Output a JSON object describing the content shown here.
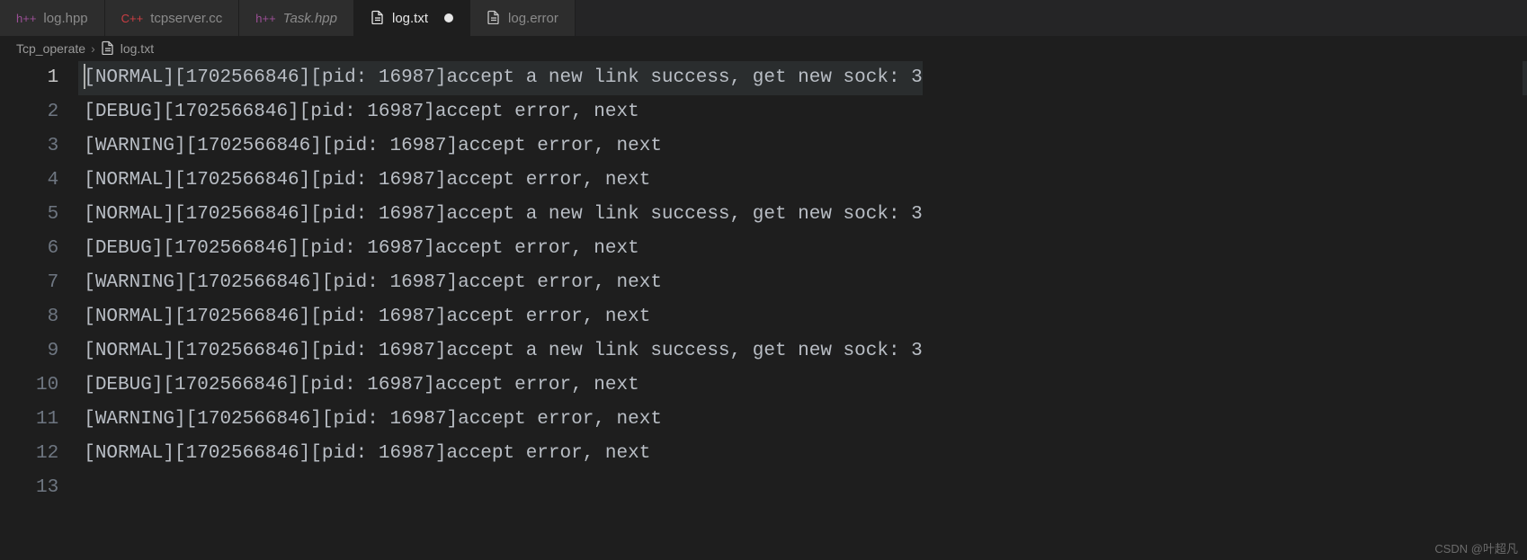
{
  "tabs": [
    {
      "ext_label": "h++",
      "ext_class": "ext-hpp",
      "label": "log.hpp",
      "italic": false,
      "active": false,
      "dirty": false
    },
    {
      "ext_label": "C++",
      "ext_class": "ext-cpp",
      "label": "tcpserver.cc",
      "italic": false,
      "active": false,
      "dirty": false
    },
    {
      "ext_label": "h++",
      "ext_class": "ext-hpp",
      "label": "Task.hpp",
      "italic": true,
      "active": false,
      "dirty": false
    },
    {
      "ext_label": "",
      "ext_class": "ext-file",
      "label": "log.txt",
      "italic": false,
      "active": true,
      "dirty": true,
      "icon": "file"
    },
    {
      "ext_label": "",
      "ext_class": "ext-file",
      "label": "log.error",
      "italic": false,
      "active": false,
      "dirty": false,
      "icon": "file"
    }
  ],
  "breadcrumb": {
    "folder": "Tcp_operate",
    "sep": "›",
    "file": "log.txt"
  },
  "editor": {
    "current_line": 1,
    "lines": [
      "[NORMAL][1702566846][pid: 16987]accept a new link success, get new sock: 3",
      "[DEBUG][1702566846][pid: 16987]accept error, next",
      "[WARNING][1702566846][pid: 16987]accept error, next",
      "[NORMAL][1702566846][pid: 16987]accept error, next",
      "[NORMAL][1702566846][pid: 16987]accept a new link success, get new sock: 3",
      "[DEBUG][1702566846][pid: 16987]accept error, next",
      "[WARNING][1702566846][pid: 16987]accept error, next",
      "[NORMAL][1702566846][pid: 16987]accept error, next",
      "[NORMAL][1702566846][pid: 16987]accept a new link success, get new sock: 3",
      "[DEBUG][1702566846][pid: 16987]accept error, next",
      "[WARNING][1702566846][pid: 16987]accept error, next",
      "[NORMAL][1702566846][pid: 16987]accept error, next",
      ""
    ]
  },
  "watermark": "CSDN @叶超凡"
}
